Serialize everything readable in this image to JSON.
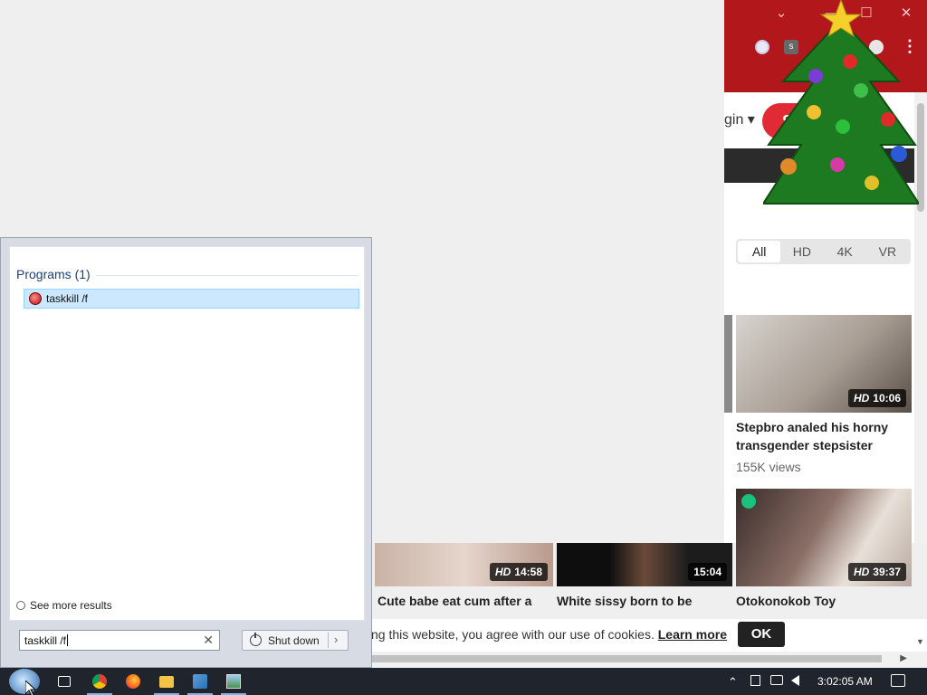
{
  "browser": {
    "window_controls": [
      "⌄",
      "—",
      "☐",
      "✕"
    ],
    "ext_label": "s",
    "menu_icon": "⋮",
    "login_text": "gin ▾",
    "signup_text": "S",
    "close_icon": "✕",
    "toolbar_color": "#b2171c"
  },
  "filters": [
    "All",
    "HD",
    "4K",
    "VR"
  ],
  "cards": [
    {
      "badge_hd": "HD",
      "duration": "10:06",
      "title_1": "Stepbro analed his horny",
      "title_2": "transgender stepsister",
      "views": "155K views"
    },
    {
      "badge_hd": "HD",
      "duration": "39:37",
      "title_1": "Otokonokob Toy"
    },
    {
      "badge_hd": "HD",
      "duration": "14:58",
      "title_1": "Cute babe eat cum after a"
    },
    {
      "badge_hd": "",
      "duration": "15:04",
      "title_1": "White sissy born to be"
    }
  ],
  "cookie": {
    "text": "ng this website, you agree with our use of cookies.",
    "link": "Learn more",
    "ok": "OK"
  },
  "start_menu": {
    "section_title": "Programs (1)",
    "result_label": "taskkill /f",
    "see_more": "See more results",
    "search_value": "taskkill /f",
    "clear_icon": "✕",
    "shutdown_label": "Shut down",
    "shutdown_arrow": "›"
  },
  "taskbar": {
    "clock": "3:02:05 AM",
    "tray_chevron": "⌃"
  }
}
